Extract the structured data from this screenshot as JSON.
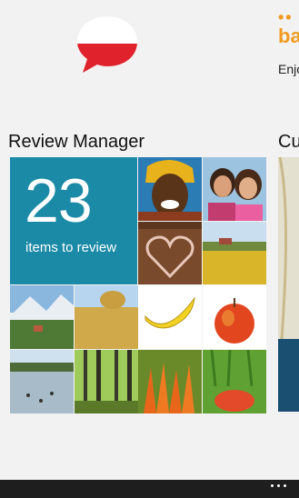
{
  "hub": {
    "peek_title": "bab",
    "peek_subtitle": "Enjo"
  },
  "sections": {
    "review_title": "Review Manager",
    "next_title": "Cu"
  },
  "review_tile": {
    "count": "23",
    "label": "items to review"
  },
  "colors": {
    "tile_blue": "#1b8aa6",
    "brand_orange": "#f29a1f",
    "flag_red": "#e0222c"
  },
  "photos": [
    "smiling-woman-photo",
    "two-girls-photo",
    "heart-sign-photo",
    "field-landscape-photo",
    "mountain-village-photo",
    "hay-bale-photo",
    "banana-photo",
    "apple-photo",
    "lake-birds-photo",
    "forest-photo",
    "carrots-photo",
    "apples-grass-photo"
  ]
}
